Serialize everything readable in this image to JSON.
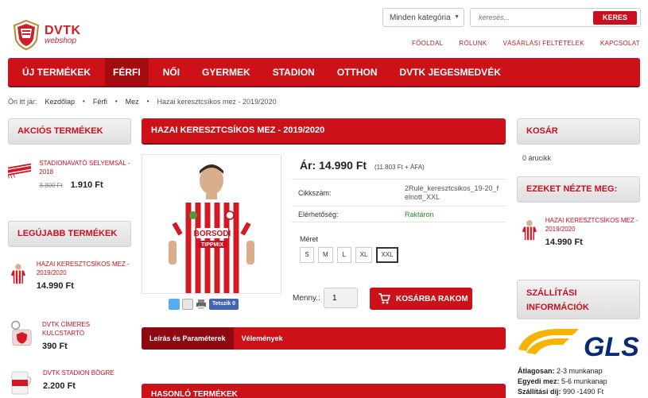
{
  "brand": {
    "name": "DVTK",
    "sub": "webshop"
  },
  "search": {
    "category": "Minden kategória",
    "placeholder": "keresés...",
    "button": "KERES"
  },
  "top_links": [
    "FŐOLDAL",
    "RÓLUNK",
    "VÁSÁRLÁSI FELTÉTELEK",
    "KAPCSOLAT"
  ],
  "nav": [
    "ÚJ TERMÉKEK",
    "FÉRFI",
    "NŐI",
    "GYERMEK",
    "STADION",
    "OTTHON",
    "DVTK JEGESMEDVÉK"
  ],
  "breadcrumb": {
    "prefix": "Ön itt jár:",
    "items": [
      "Kezdőlap",
      "Férfi",
      "Mez",
      "Hazai keresztcsíkos mez - 2019/2020"
    ]
  },
  "left": {
    "sale_title": "AKCIÓS TERMÉKEK",
    "sale_item": {
      "name": "STADIONAVATÓ SELYEMSÁL - 2018",
      "old_price": "3.300 Ft",
      "price": "1.910 Ft"
    },
    "newest_title": "LEGÚJABB TERMÉKEK",
    "newest": [
      {
        "name": "HAZAI KERESZTCSÍKOS MEZ - 2019/2020",
        "price": "14.990 Ft"
      },
      {
        "name": "DVTK CÍMERES KULCSTARTÓ",
        "price": "390 Ft"
      },
      {
        "name": "DVTK STADION BÖGRE",
        "price": "2.200 Ft"
      }
    ]
  },
  "product": {
    "title": "HAZAI KERESZTCSÍKOS MEZ - 2019/2020",
    "price_label": "Ár:",
    "price": "14.990 Ft",
    "net_price": "(11.803 Ft + ÁFA)",
    "sku_label": "Cikkszám:",
    "sku": "2Rule_keresztcsikos_19-20_felnott_XXL",
    "avail_label": "Elérhetőség:",
    "avail": "Raktáron",
    "size_label": "Méret",
    "sizes": [
      "S",
      "M",
      "L",
      "XL",
      "XXL"
    ],
    "selected_size": "XXL",
    "qty_label": "Menny.:",
    "qty": "1",
    "add_to_cart": "KOSÁRBA RAKOM",
    "like": "Tetszik 0",
    "shirt_text_1": "BORSODI",
    "shirt_text_2": "TIPPMIX"
  },
  "tabs": [
    "Leírás és Paraméterek",
    "Vélemények"
  ],
  "similar_title": "HASONLÓ TERMÉKEK",
  "right": {
    "cart_title": "KOSÁR",
    "cart_count": "0 árucikk",
    "viewed_title": "EZEKET NÉZTE MEG:",
    "viewed_item": {
      "name": "HAZAI KERESZTCSÍKOS MEZ - 2019/2020",
      "price": "14.990 Ft"
    },
    "ship_title": "SZÁLLÍTÁSI INFORMÁCIÓK",
    "gls": "GLS",
    "ship_avg_label": "Átlagosan:",
    "ship_avg": "2-3 munkanap",
    "ship_custom_label": "Egyedi mez:",
    "ship_custom": "5-6 munkanap",
    "ship_fee_label": "Szállítási díj:",
    "ship_fee": "990 -1490 Ft"
  },
  "colors": {
    "brand_red": "#cc1218",
    "dark_red": "#8e0a10",
    "in_stock": "#2e8b2e"
  }
}
